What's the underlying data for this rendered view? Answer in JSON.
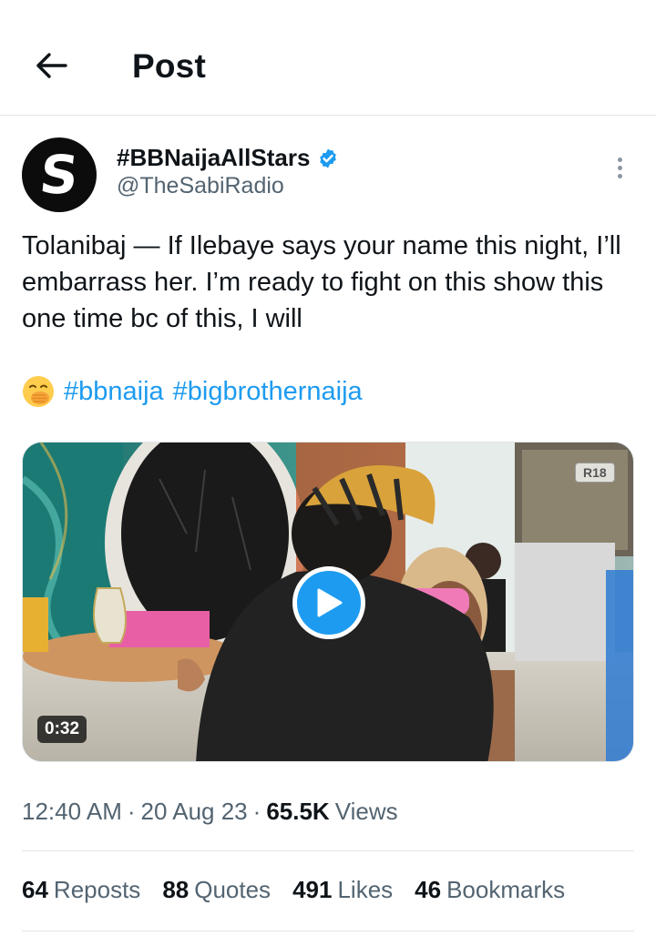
{
  "header": {
    "title": "Post",
    "back_icon": "arrow-left-icon"
  },
  "author": {
    "avatar_letter": "S",
    "display_name": "#BBNaijaAllStars",
    "handle": "@TheSabiRadio",
    "verified_icon": "verified-badge-icon",
    "verified_color": "#1d9bf0"
  },
  "tweet": {
    "text": "Tolanibaj — If Ilebaye says your name this night, I’ll embarrass her. I’m ready to fight on this show this one time bc of this, I will",
    "emoji": "hand-over-mouth-emoji",
    "hashtags": [
      "#bbnaija",
      "#bigbrothernaija"
    ]
  },
  "media": {
    "duration": "0:32",
    "rating": "R18",
    "play_icon": "play-icon"
  },
  "meta": {
    "time": "12:40 AM",
    "date": "20 Aug 23",
    "views_count": "65.5K",
    "views_label": "Views",
    "separator": "·"
  },
  "stats": {
    "reposts": {
      "count": "64",
      "label": "Reposts"
    },
    "quotes": {
      "count": "88",
      "label": "Quotes"
    },
    "likes": {
      "count": "491",
      "label": "Likes"
    },
    "bookmarks": {
      "count": "46",
      "label": "Bookmarks"
    }
  },
  "colors": {
    "accent": "#1d9bf0",
    "text": "#0f1419",
    "muted": "#536471"
  }
}
